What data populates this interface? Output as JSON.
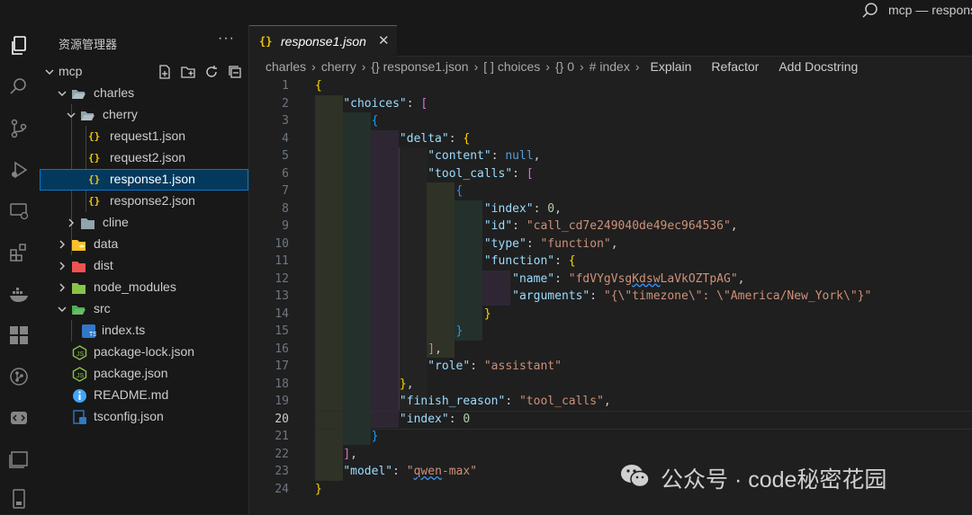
{
  "window": {
    "title": "mcp — respons"
  },
  "explorer": {
    "title": "资源管理器",
    "more": "···",
    "items": [
      {
        "label": "mcp",
        "type": "folder-open"
      },
      {
        "label": "charles",
        "type": "folder-open"
      },
      {
        "label": "cherry",
        "type": "folder-open"
      },
      {
        "label": "request1.json",
        "type": "json"
      },
      {
        "label": "request2.json",
        "type": "json"
      },
      {
        "label": "response1.json",
        "type": "json"
      },
      {
        "label": "response2.json",
        "type": "json"
      },
      {
        "label": "cline",
        "type": "folder"
      },
      {
        "label": "data",
        "type": "folder-yellow"
      },
      {
        "label": "dist",
        "type": "folder-red"
      },
      {
        "label": "node_modules",
        "type": "folder-green"
      },
      {
        "label": "src",
        "type": "folder-src"
      },
      {
        "label": "index.ts",
        "type": "ts"
      },
      {
        "label": "package-lock.json",
        "type": "npm"
      },
      {
        "label": "package.json",
        "type": "npm"
      },
      {
        "label": "README.md",
        "type": "info"
      },
      {
        "label": "tsconfig.json",
        "type": "tsconfig"
      }
    ]
  },
  "tab": {
    "icon": "{}",
    "name": "response1.json",
    "close": "✕"
  },
  "breadcrumb": {
    "parts": [
      "charles",
      "cherry",
      "{} response1.json",
      "[ ] choices",
      "{} 0",
      "# index"
    ],
    "codelens": [
      "Explain",
      "Refactor",
      "Add Docstring"
    ]
  },
  "editor": {
    "line_numbers": [
      "1",
      "2",
      "3",
      "4",
      "5",
      "6",
      "7",
      "8",
      "9",
      "10",
      "11",
      "12",
      "13",
      "14",
      "15",
      "16",
      "17",
      "18",
      "19",
      "20",
      "21",
      "22",
      "23",
      "24"
    ],
    "active_line": 20,
    "code_text": {
      "choices": "\"choices\"",
      "delta": "\"delta\"",
      "content": "\"content\"",
      "null": "null",
      "tool_calls": "\"tool_calls\"",
      "index": "\"index\"",
      "zero": "0",
      "id": "\"id\"",
      "id_val": "\"call_cd7e249040de49ec964536\"",
      "type": "\"type\"",
      "type_val": "\"function\"",
      "function": "\"function\"",
      "name": "\"name\"",
      "name_val_a": "\"fdVYgVsg",
      "name_val_b": "Kdsw",
      "name_val_c": "LaVkOZTpAG\"",
      "arguments": "\"arguments\"",
      "arguments_val": "\"{\\\"timezone\\\": \\\"America/New_York\\\"}\"",
      "role": "\"role\"",
      "role_val": "\"assistant\"",
      "finish_reason": "\"finish_reason\"",
      "finish_val": "\"tool_calls\"",
      "model": "\"model\"",
      "model_val_a": "\"",
      "model_val_b": "qwen",
      "model_val_c": "-max\""
    }
  },
  "watermark": {
    "text": "公众号 · code秘密花园"
  },
  "colors": {
    "accent": "#0078d4",
    "selection": "#04395e",
    "key": "#9cdcfe",
    "string": "#ce9178",
    "number": "#b5cea8",
    "keyword": "#569cd6"
  }
}
